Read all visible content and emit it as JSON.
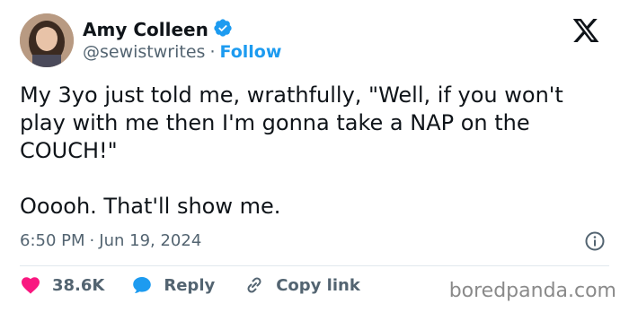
{
  "author": {
    "name": "Amy Colleen",
    "handle": "@sewistwrites",
    "separator": "·",
    "follow_label": "Follow",
    "verified_icon": "verified-badge-icon",
    "verified_color": "#1d9bf0"
  },
  "brand_icon": "x-logo-icon",
  "tweet": {
    "paragraph_1": "My 3yo just told me, wrathfully, \"Well, if you won't play with me then I'm gonna take a NAP on the COUCH!\"",
    "paragraph_2": "Ooooh. That'll show me."
  },
  "meta": {
    "time": "6:50 PM",
    "separator": "·",
    "date": "Jun 19, 2024",
    "info_icon": "info-icon"
  },
  "actions": {
    "likes": "38.6K",
    "like_icon": "heart-icon",
    "like_color": "#f91880",
    "reply_label": "Reply",
    "reply_icon": "speech-bubble-icon",
    "reply_color": "#1d9bf0",
    "copy_label": "Copy link",
    "copy_icon": "link-icon"
  },
  "watermark": "boredpanda.com"
}
